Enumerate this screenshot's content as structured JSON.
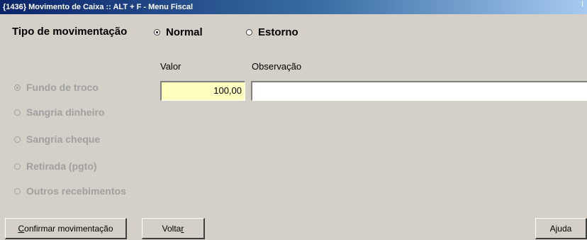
{
  "window": {
    "title": "{1436} Movimento de Caixa :: ALT + F - Menu Fiscal",
    "title_right": "I"
  },
  "tipo": {
    "label": "Tipo de movimentação",
    "options": [
      {
        "label": "Normal",
        "checked": true
      },
      {
        "label": "Estorno",
        "checked": false
      }
    ]
  },
  "columns": {
    "valor": "Valor",
    "observacao": "Observação"
  },
  "categories": [
    {
      "label": "Fundo de troco",
      "checked": true
    },
    {
      "label": "Sangria dinheiro",
      "checked": false
    },
    {
      "label": "Sangria cheque",
      "checked": false
    },
    {
      "label": "Retirada (pgto)",
      "checked": false
    },
    {
      "label": "Outros recebimentos",
      "checked": false
    }
  ],
  "fields": {
    "valor_value": "100,00",
    "observacao_value": ""
  },
  "buttons": {
    "confirmar_first": "C",
    "confirmar_rest": "onfirmar movimentação",
    "voltar_first": "Volta",
    "voltar_rest": "r",
    "ajuda": "Ajuda"
  },
  "colors": {
    "title_bar": "#0a246a",
    "window_bg": "#d4d0c8",
    "valor_bg": "#ffffc0",
    "disabled_text": "#a0a0a0"
  }
}
